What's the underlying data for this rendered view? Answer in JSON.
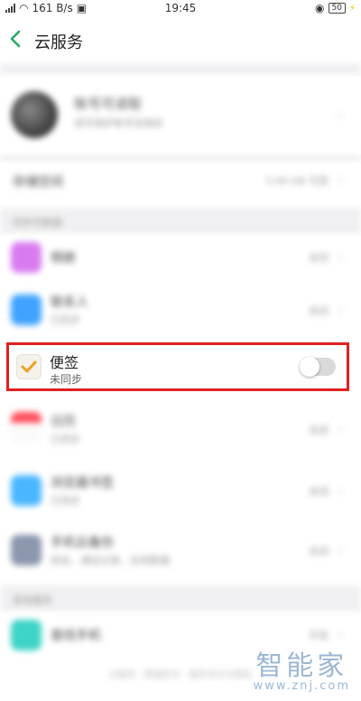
{
  "status_bar": {
    "network_speed": "161 B/s",
    "time": "19:45",
    "battery": "50"
  },
  "header": {
    "title": "云服务"
  },
  "profile": {
    "name": "账号可读取",
    "sub": "读写保护账号及相关",
    "icon": "avatar"
  },
  "storage": {
    "label": "存储空间",
    "value": "5.00 GB 可用"
  },
  "section_apps": {
    "label": "同步的数据"
  },
  "apps": [
    {
      "name": "相册",
      "sub": "",
      "status": "关闭",
      "color": "#d97bf0"
    },
    {
      "name": "联系人",
      "sub": "已同步",
      "status": "关闭",
      "color": "#3fa3ff"
    },
    {
      "name": "便签",
      "sub": "未同步",
      "status": "",
      "color": "#f5f2ec",
      "toggle_on": false
    },
    {
      "name": "日历",
      "sub": "已同步",
      "status": "关闭",
      "color": "#ff4d5a"
    },
    {
      "name": "浏览器书签",
      "sub": "已同步",
      "status": "关闭",
      "color": "#49b6ff"
    },
    {
      "name": "手机云备份",
      "sub": "短信、通话记录、应用数据",
      "status": "关闭",
      "color": "#8c96ad"
    }
  ],
  "section_other": {
    "label": "其他服务"
  },
  "other_apps": [
    {
      "name": "查找手机",
      "status": "开启",
      "color": "#3ed4c7"
    }
  ],
  "footer": {
    "text": "云服务 · 数据安全 · 服务协议与隐私"
  },
  "watermark": {
    "big": "智能家",
    "small": "www.znj.com"
  }
}
